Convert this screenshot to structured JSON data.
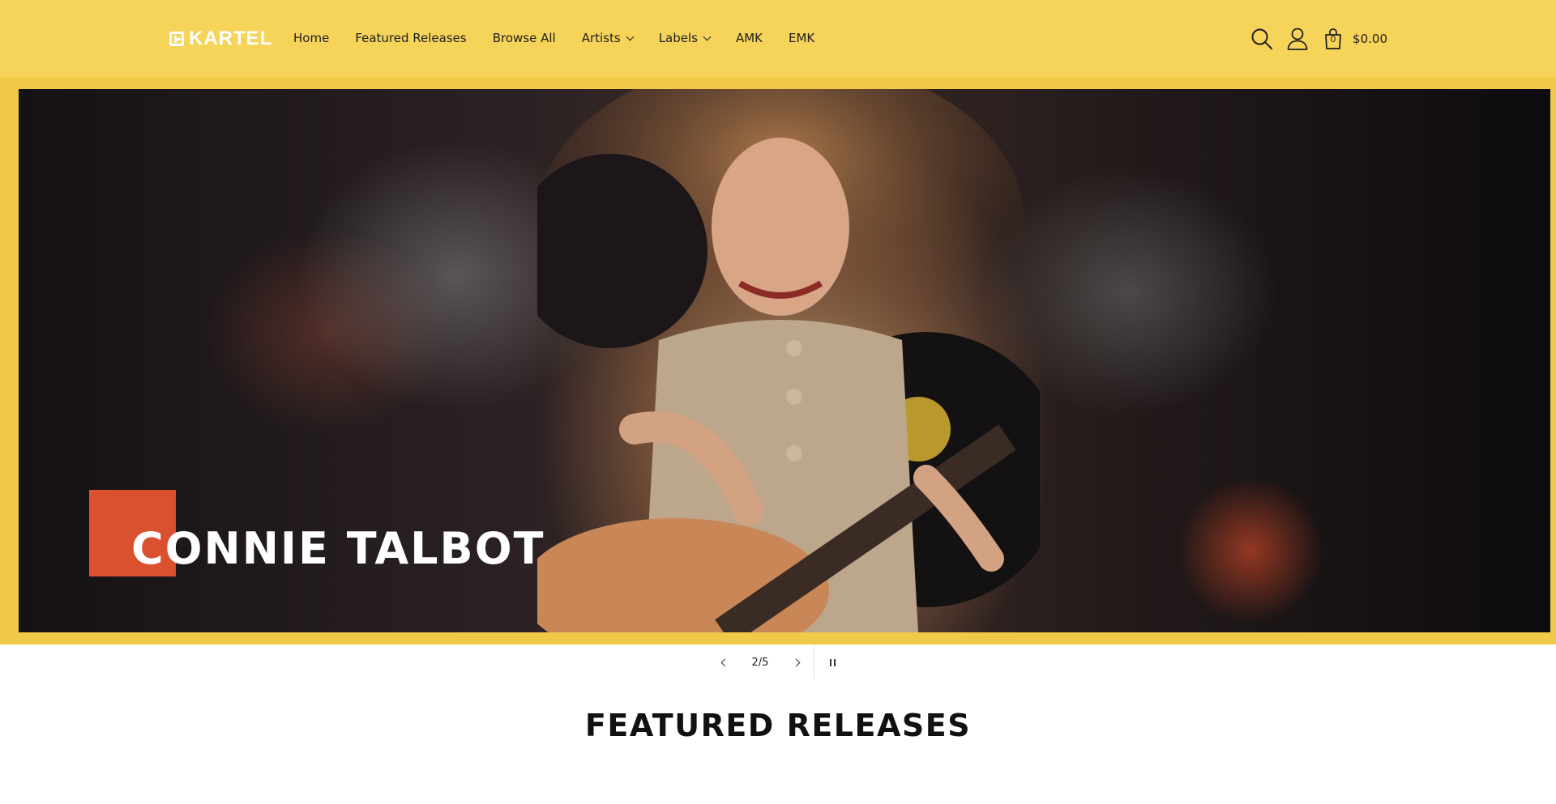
{
  "header": {
    "logo_text": "KARTEL",
    "nav": [
      {
        "label": "Home",
        "has_dropdown": false
      },
      {
        "label": "Featured Releases",
        "has_dropdown": false
      },
      {
        "label": "Browse All",
        "has_dropdown": false
      },
      {
        "label": "Artists",
        "has_dropdown": true
      },
      {
        "label": "Labels",
        "has_dropdown": true
      },
      {
        "label": "AMK",
        "has_dropdown": false
      },
      {
        "label": "EMK",
        "has_dropdown": false
      }
    ],
    "icons": [
      "search-icon",
      "account-icon",
      "cart-icon"
    ],
    "cart_count": "0",
    "cart_total": "$0.00"
  },
  "hero": {
    "title": "CONNIE TALBOT",
    "accent_color": "#d9512f"
  },
  "slider": {
    "counter": "2/5"
  },
  "sections": {
    "featured_title": "FEATURED RELEASES"
  },
  "colors": {
    "header_bg": "#f6d45a",
    "hero_frame": "#f0c948"
  }
}
